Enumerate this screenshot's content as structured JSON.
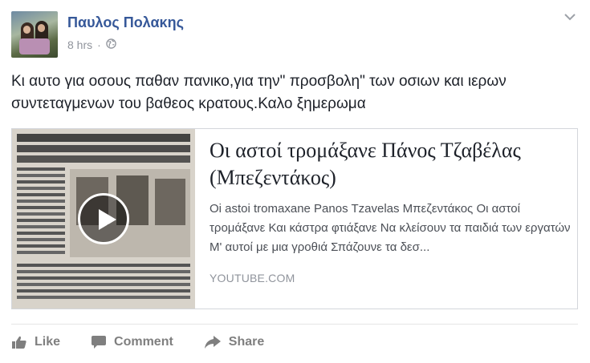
{
  "post": {
    "author": "Παυλος Πολακης",
    "time": "8 hrs",
    "separator": "·",
    "privacy_icon": "globe-icon",
    "menu_icon": "chevron-down-icon",
    "message": "Κι αυτο για οσους παθαν πανικο,για την\" προσβολη\" των οσιων και ιερων συντεταγμενων του βαθεος κρατους.Καλο ξημερωμα"
  },
  "link": {
    "title": "Οι αστοί τρομάξανε Πάνος Τζαβέλας (Μπεζεντάκος)",
    "description": "Oi astoi tromaxane Panos Tzavelas Μπεζεντάκος Οι αστοί τρομάξανε Και κάστρα φτιάξανε Να κλείσουν τα παιδιά των εργατών Μ' αυτοί με μια γροθιά Σπάζουνε τα δεσ...",
    "source": "YOUTUBE.COM",
    "thumbnail_icon": "play-icon"
  },
  "actions": {
    "like": "Like",
    "comment": "Comment",
    "share": "Share"
  },
  "colors": {
    "author": "#365899",
    "muted": "#90949c",
    "action": "#7f7f7f",
    "border": "#d3d6db"
  }
}
